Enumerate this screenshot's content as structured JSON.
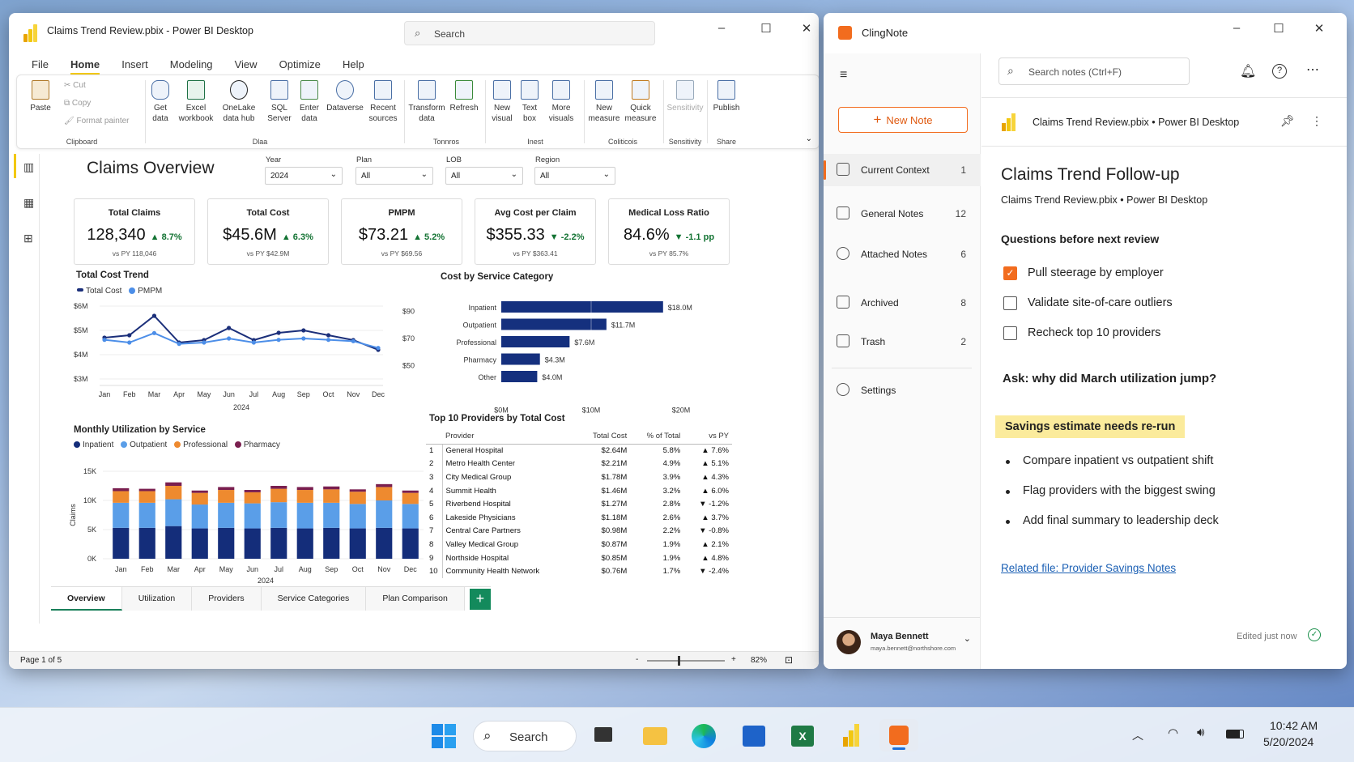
{
  "pbi": {
    "title": "Claims Trend Review.pbix - Power BI Desktop",
    "search_placeholder": "Search",
    "menu": [
      "File",
      "Home",
      "Insert",
      "Modeling",
      "View",
      "Optimize",
      "Help"
    ],
    "active_menu": "Home",
    "ribbon": {
      "paste": "Paste",
      "cut": "Cut",
      "copy": "Copy",
      "format_painter": "Format painter",
      "get_data": "Get data",
      "excel": "Excel workbook",
      "onelake": "OneLake data hub",
      "sql": "SQL Server",
      "enter_data": "Enter data",
      "dataverse": "Dataverse",
      "recent": "Recent sources",
      "transform": "Transform data",
      "refresh": "Refresh",
      "new_visual": "New visual",
      "text_box": "Text box",
      "more_visuals": "More visuals",
      "new_measure": "New measure",
      "quick_measure": "Quick measure",
      "sensitivity": "Sensitivity",
      "publish": "Publish",
      "groups": {
        "clipboard": "Clipboard",
        "data": "Dlaa",
        "queries": "Tonnros",
        "insert": "Inest",
        "calc": "Coliticois",
        "sensitivity": "Sensitivity",
        "share": "Share"
      }
    },
    "report": {
      "title": "Claims Overview",
      "slicers": [
        {
          "label": "Year",
          "value": "2024"
        },
        {
          "label": "Plan",
          "value": "All"
        },
        {
          "label": "LOB",
          "value": "All"
        },
        {
          "label": "Region",
          "value": "All"
        }
      ],
      "cards": [
        {
          "title": "Total Claims",
          "value": "128,340",
          "delta": "▲ 8.7%",
          "py": "vs PY 118,046"
        },
        {
          "title": "Total Cost",
          "value": "$45.6M",
          "delta": "▲ 6.3%",
          "py": "vs PY $42.9M"
        },
        {
          "title": "PMPM",
          "value": "$73.21",
          "delta": "▲ 5.2%",
          "py": "vs PY $69.56"
        },
        {
          "title": "Avg Cost per Claim",
          "value": "$355.33",
          "delta": "▼ -2.2%",
          "py": "vs PY $363.41"
        },
        {
          "title": "Medical Loss Ratio",
          "value": "84.6%",
          "delta": "▼ -1.1 pp",
          "py": "vs PY 85.7%"
        }
      ],
      "trend_title": "Total Cost Trend",
      "trend_legend": [
        "Total Cost",
        "PMPM"
      ],
      "service_title": "Cost by Service Category",
      "util_title": "Monthly Utilization by Service",
      "util_legend": [
        "Inpatient",
        "Outpatient",
        "Professional",
        "Pharmacy"
      ],
      "util_ylabel": "Claims",
      "providers_title": "Top 10 Providers by Total Cost",
      "providers_headers": [
        "Provider",
        "Total Cost",
        "% of Total",
        "vs PY"
      ],
      "providers": [
        [
          "1",
          "General Hospital",
          "$2.64M",
          "5.8%",
          "▲ 7.6%"
        ],
        [
          "2",
          "Metro Health Center",
          "$2.21M",
          "4.9%",
          "▲ 5.1%"
        ],
        [
          "3",
          "City Medical Group",
          "$1.78M",
          "3.9%",
          "▲ 4.3%"
        ],
        [
          "4",
          "Summit Health",
          "$1.46M",
          "3.2%",
          "▲ 6.0%"
        ],
        [
          "5",
          "Riverbend Hospital",
          "$1.27M",
          "2.8%",
          "▼ -1.2%"
        ],
        [
          "6",
          "Lakeside Physicians",
          "$1.18M",
          "2.6%",
          "▲ 3.7%"
        ],
        [
          "7",
          "Central Care Partners",
          "$0.98M",
          "2.2%",
          "▼ -0.8%"
        ],
        [
          "8",
          "Valley Medical Group",
          "$0.87M",
          "1.9%",
          "▲ 2.1%"
        ],
        [
          "9",
          "Northside Hospital",
          "$0.85M",
          "1.9%",
          "▲ 4.8%"
        ],
        [
          "10",
          "Community Health Network",
          "$0.76M",
          "1.7%",
          "▼ -2.4%"
        ]
      ]
    },
    "page_tabs": [
      "Overview",
      "Utilization",
      "Providers",
      "Service Categories",
      "Plan Comparison"
    ],
    "page_status": "Page 1 of 5",
    "zoom": "82%"
  },
  "chart_data": [
    {
      "type": "line",
      "title": "Total Cost Trend",
      "categories": [
        "Jan",
        "Feb",
        "Mar",
        "Apr",
        "May",
        "Jun",
        "Jul",
        "Aug",
        "Sep",
        "Oct",
        "Nov",
        "Dec"
      ],
      "xlabel": "2024",
      "y_ticks": [
        "$3M",
        "$4M",
        "$5M",
        "$6M"
      ],
      "y2_ticks": [
        "$50",
        "$70",
        "$90"
      ],
      "ylim": [
        3,
        6
      ],
      "y2lim": [
        40,
        94
      ],
      "series": [
        {
          "name": "Total Cost",
          "axis": "left",
          "color": "#1b2f7a",
          "values": [
            4.7,
            4.8,
            5.6,
            4.5,
            4.6,
            5.1,
            4.6,
            4.9,
            5.0,
            4.8,
            4.6,
            4.2
          ]
        },
        {
          "name": "PMPM",
          "axis": "right",
          "color": "#4c8ee8",
          "values": [
            69,
            67,
            74,
            66,
            67,
            70,
            67,
            69,
            70,
            69,
            68,
            63
          ]
        }
      ]
    },
    {
      "type": "bar",
      "orientation": "horizontal",
      "title": "Cost by Service Category",
      "categories": [
        "Inpatient",
        "Outpatient",
        "Professional",
        "Pharmacy",
        "Other"
      ],
      "values": [
        18.0,
        11.7,
        7.6,
        4.3,
        4.0
      ],
      "labels": [
        "$18.0M",
        "$11.7M",
        "$7.6M",
        "$4.3M",
        "$4.0M"
      ],
      "x_ticks": [
        "$0M",
        "$10M",
        "$20M"
      ],
      "xlim": [
        0,
        20
      ]
    },
    {
      "type": "bar",
      "stacked": true,
      "title": "Monthly Utilization by Service",
      "categories": [
        "Jan",
        "Feb",
        "Mar",
        "Apr",
        "May",
        "Jun",
        "Jul",
        "Aug",
        "Sep",
        "Oct",
        "Nov",
        "Dec"
      ],
      "xlabel": "2024",
      "ylabel": "Claims",
      "y_ticks": [
        "0K",
        "5K",
        "10K",
        "15K"
      ],
      "ylim": [
        0,
        15000
      ],
      "series": [
        {
          "name": "Inpatient",
          "color": "#142d7a",
          "values": [
            5300,
            5300,
            5600,
            5200,
            5300,
            5200,
            5300,
            5200,
            5300,
            5200,
            5300,
            5200
          ]
        },
        {
          "name": "Outpatient",
          "color": "#5a9ee8",
          "values": [
            4300,
            4300,
            4600,
            4100,
            4300,
            4300,
            4400,
            4400,
            4300,
            4200,
            4700,
            4200
          ]
        },
        {
          "name": "Professional",
          "color": "#ee8a2f",
          "values": [
            2000,
            2000,
            2300,
            2000,
            2200,
            1900,
            2300,
            2200,
            2300,
            2100,
            2300,
            1900
          ]
        },
        {
          "name": "Pharmacy",
          "color": "#7a1f4f",
          "values": [
            500,
            400,
            600,
            400,
            500,
            400,
            500,
            500,
            500,
            400,
            500,
            400
          ]
        }
      ]
    }
  ],
  "clingnote": {
    "title": "ClingNote",
    "search_placeholder": "Search notes (Ctrl+F)",
    "new_note": "New Note",
    "nav": [
      {
        "label": "Current Context",
        "count": "1"
      },
      {
        "label": "General Notes",
        "count": "12"
      },
      {
        "label": "Attached Notes",
        "count": "6"
      },
      {
        "label": "Archived",
        "count": "8"
      },
      {
        "label": "Trash",
        "count": "2"
      },
      {
        "label": "Settings",
        "count": ""
      }
    ],
    "context": "Claims Trend Review.pbix • Power BI Desktop",
    "note_title": "Claims Trend Follow-up",
    "note_subtitle": "Claims Trend Review.pbix • Power BI Desktop",
    "section": "Questions before next review",
    "checklist": [
      {
        "text": "Pull steerage by employer",
        "checked": true
      },
      {
        "text": "Validate site-of-care outliers",
        "checked": false
      },
      {
        "text": "Recheck top 10 providers",
        "checked": false
      }
    ],
    "ask": "Ask: why did March utilization jump?",
    "highlight": "Savings estimate needs re-run",
    "bullets": [
      "Compare inpatient vs outpatient shift",
      "Flag providers with the biggest swing",
      "Add final summary to leadership deck"
    ],
    "link": "Related file: Provider Savings Notes",
    "user_name": "Maya Bennett",
    "user_email": "maya.bennett@northshore.com",
    "saved": "Edited just now"
  },
  "taskbar": {
    "search": "Search",
    "time": "10:42 AM",
    "date": "5/20/2024"
  }
}
